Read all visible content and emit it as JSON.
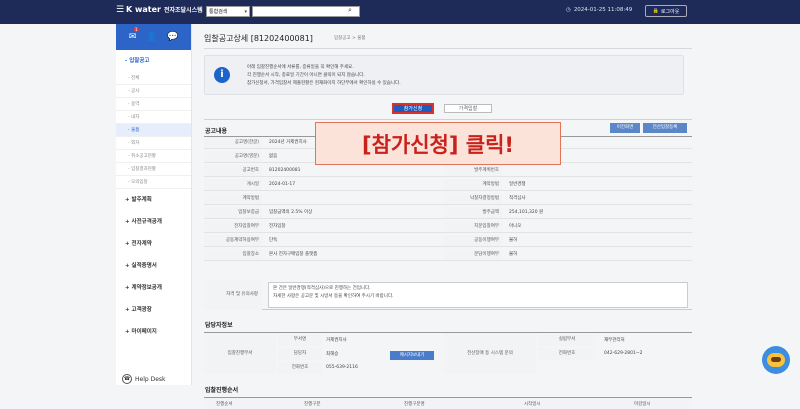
{
  "topbar": {
    "logo_k": "K water",
    "logo_title": "전자조달시스템",
    "search_select": "통합검색",
    "clock": "2024-01-25 11:08:49",
    "logout": "로그아웃"
  },
  "sidebar": {
    "badge": "1",
    "menu_open": "입찰공고",
    "sub_items": [
      "전체",
      "공사",
      "용역",
      "내자",
      "물품",
      "외자",
      "취소공고현황",
      "입찰결과현황",
      "모의입찰"
    ],
    "active_index": 4,
    "top_items": [
      "발주계획",
      "사전규격공개",
      "전자계약",
      "실적증명서",
      "계약정보공개",
      "고객광장",
      "마이페이지"
    ],
    "helpdesk": "Help Desk"
  },
  "main": {
    "title": "입찰공고상세 [81202400081]",
    "breadcrumb": "입찰공고 > 물품",
    "info_lines": [
      "아래 입찰진행순서에 서류를, 증류일을 꼭 확인해 주세요.",
      "각 진행순서 시작, 종료일 기간이 아니면 클릭이 되지 않습니다.",
      "참가신청서, 가격입찰서 제출현황은 현재화이지 하단부에서 확인하실 수 있습니다."
    ],
    "tab_apply": "참가신청",
    "tab_price": "가격입찰",
    "section_bid": "공고내용",
    "btn_small_1": "이전화면",
    "btn_small_2": "전산입찰등록",
    "overlay_text": "[참가신청] 클릭!",
    "bid_rows": [
      {
        "label": "공고명(한글)",
        "value": "2024년 거제권지사"
      },
      {
        "label": "공고명(영문)",
        "value": "없음"
      },
      {
        "label": "공고번호",
        "value": "81202400081",
        "label2": "발주계획번호",
        "value2": ""
      },
      {
        "label": "게시일",
        "value": "2024-01-17",
        "label2": "계약방법",
        "value2": "일반경쟁"
      },
      {
        "label": "계약방법",
        "value": "",
        "label2": "낙찰자결정방법",
        "value2": "적격심사"
      },
      {
        "label": "입찰보증금",
        "value": "입찰금액의 2.5% 이상",
        "label2": "발주금액",
        "value2": "254,101,320 원"
      },
      {
        "label": "전자입찰여부",
        "value": "전자입찰",
        "label2": "지문입찰여부",
        "value2": "아니오"
      },
      {
        "label": "공동계약허용여부",
        "value": "단독",
        "label2": "공동이행여부",
        "value2": "불허"
      },
      {
        "label": "입찰장소",
        "value": "본사 전자구매입찰 플랫폼",
        "label2": "분담이행여부",
        "value2": "불허"
      }
    ],
    "remarks_label": "자격 및 유의사항",
    "remarks_lines": [
      "본 건은 일반경쟁(적격심사)으로 진행하는 건입니다.",
      "자세한 사항은 공고문 및 시방서 등을 확인하여 주시기 바랍니다."
    ],
    "section_contact": "담당자정보",
    "contact": {
      "group_label": "입찰진행부서",
      "dept_label": "부서명",
      "dept_value": "거제권지사",
      "person_label": "담당자",
      "person_value": "최해승",
      "mail_btn": "메시지보내기",
      "phone_label": "전화번호",
      "phone_value": "055-639-2116",
      "email_label": "전산장애 등 시스템 문의",
      "req_dept_label": "실립부서",
      "req_dept_value": "재무관리처",
      "req_phone_label": "전화번호",
      "req_phone_value": "042-629-2801~2"
    },
    "section_process": "입찰진행순서",
    "process_headers": [
      "진행순서",
      "진행구분",
      "진행구분명",
      "시작일시",
      "마감일시"
    ]
  }
}
